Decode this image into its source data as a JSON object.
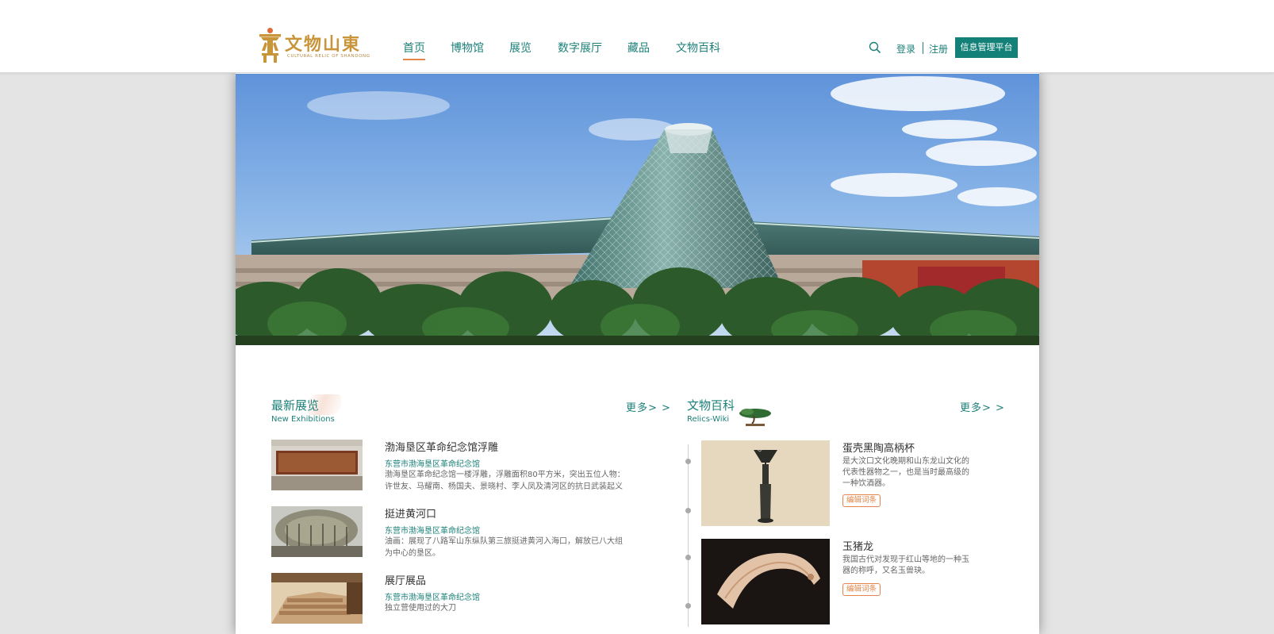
{
  "header": {
    "logo": {
      "cn": "文物山東",
      "en": "CULTURAL RELIC OF SHANDONG"
    },
    "nav": [
      {
        "label": "首页",
        "active": true
      },
      {
        "label": "博物馆",
        "active": false
      },
      {
        "label": "展览",
        "active": false
      },
      {
        "label": "数字展厅",
        "active": false
      },
      {
        "label": "藏品",
        "active": false
      },
      {
        "label": "文物百科",
        "active": false
      }
    ],
    "login": "登录",
    "register": "注册",
    "platform_button": "信息管理平台"
  },
  "exhibitions": {
    "title": "最新展览",
    "subtitle": "New Exhibitions",
    "more": "更多> >",
    "items": [
      {
        "title": "渤海垦区革命纪念馆浮雕",
        "venue": "东营市渤海垦区革命纪念馆",
        "desc": "渤海垦区革命纪念馆一楼浮雕，浮雕面积80平方米，突出五位人物：许世友、马耀南、杨国夫、景晓村、李人凤及清河区的抗日武装起义"
      },
      {
        "title": "挺进黄河口",
        "venue": "东营市渤海垦区革命纪念馆",
        "desc": "油画：展现了八路军山东纵队第三旅挺进黄河入海口，解放已八大组为中心的垦区。"
      },
      {
        "title": "展厅展品",
        "venue": "东营市渤海垦区革命纪念馆",
        "desc": "独立营使用过的大刀"
      }
    ]
  },
  "wiki": {
    "title": "文物百科",
    "subtitle": "Relics-Wiki",
    "more": "更多> >",
    "items": [
      {
        "title": "蛋壳黑陶高柄杯",
        "desc": "是大汶口文化晚期和山东龙山文化的代表性器物之一，也是当时最高级的一种饮酒器。",
        "edit": "编辑词条"
      },
      {
        "title": "玉猪龙",
        "desc": "我国古代对发现于红山等地的一种玉器的称呼，又名玉兽玦。",
        "edit": "编辑词条"
      }
    ]
  },
  "colors": {
    "teal": "#1d8079",
    "button": "#138178",
    "accent_orange": "#e2864c",
    "logo_gold": "#c8953a"
  },
  "icons": [
    "search-icon",
    "logo-emblem-icon",
    "bonsai-icon"
  ]
}
